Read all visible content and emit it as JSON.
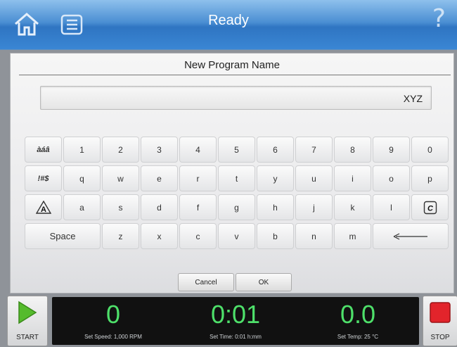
{
  "header": {
    "title": "Ready",
    "help_glyph": "?",
    "home_icon": "home-icon",
    "menu_icon": "list-icon"
  },
  "dialog": {
    "title": "New Program Name",
    "input_value": "XYZ",
    "cancel_label": "Cancel",
    "ok_label": "OK"
  },
  "keyboard": {
    "row1": [
      "àáâ",
      "1",
      "2",
      "3",
      "4",
      "5",
      "6",
      "7",
      "8",
      "9",
      "0"
    ],
    "row2": [
      "!#$",
      "q",
      "w",
      "e",
      "r",
      "t",
      "y",
      "u",
      "i",
      "o",
      "p"
    ],
    "row3": [
      "A-shift",
      "a",
      "s",
      "d",
      "f",
      "g",
      "h",
      "j",
      "k",
      "l",
      "C-clear"
    ],
    "row4": [
      "Space",
      "z",
      "x",
      "c",
      "v",
      "b",
      "n",
      "m",
      "backspace"
    ]
  },
  "controls": {
    "start_label": "START",
    "stop_label": "STOP"
  },
  "status": {
    "speed_value": "0",
    "speed_label": "Set Speed: 1,000 RPM",
    "time_value": "0:01",
    "time_label": "Set Time: 0:01 h:mm",
    "temp_value": "0.0",
    "temp_label": "Set Temp: 25 °C"
  },
  "colors": {
    "header_blue": "#3a86d4",
    "digits_green": "#4ee06a",
    "stop_red": "#e2242b",
    "start_green": "#55bb2c"
  }
}
